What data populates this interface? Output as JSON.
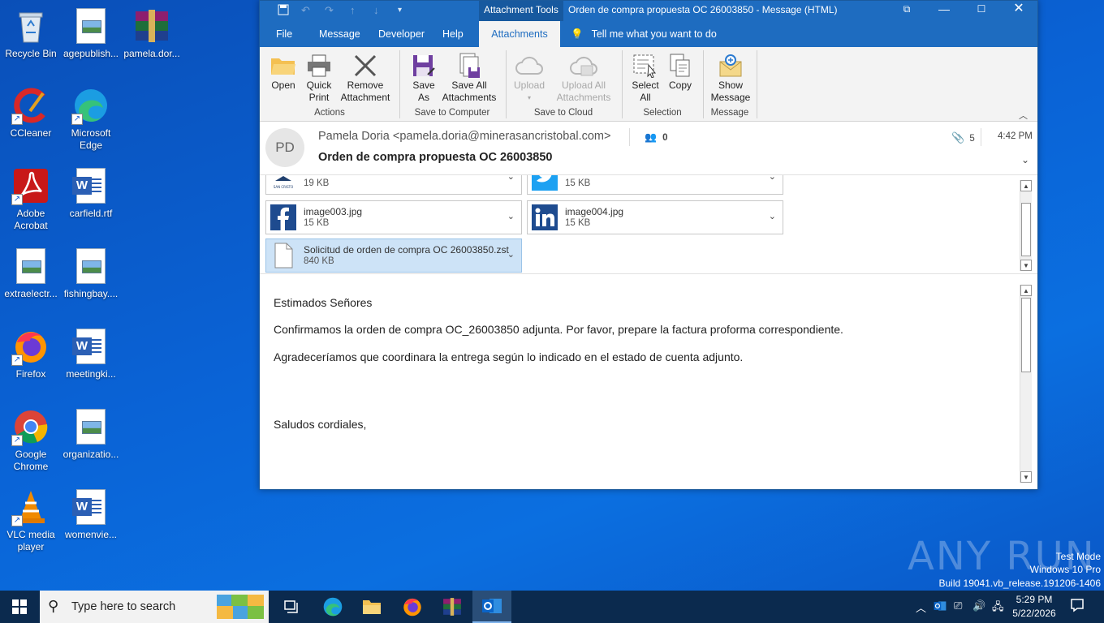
{
  "desktop": {
    "icons": [
      {
        "label": "Recycle Bin"
      },
      {
        "label": "agepublish..."
      },
      {
        "label": "pamela.dor..."
      },
      {
        "label": "CCleaner"
      },
      {
        "label": "Microsoft Edge"
      },
      {
        "label": "Adobe Acrobat"
      },
      {
        "label": "carfield.rtf"
      },
      {
        "label": "extraelectr..."
      },
      {
        "label": "fishingbay...."
      },
      {
        "label": "Firefox"
      },
      {
        "label": "meetingki..."
      },
      {
        "label": "Google Chrome"
      },
      {
        "label": "organizatio..."
      },
      {
        "label": "VLC media player"
      },
      {
        "label": "womenvie..."
      }
    ]
  },
  "window": {
    "context_tab": "Attachment Tools",
    "title": "Orden de compra propuesta OC 26003850  -  Message (HTML)",
    "tabs": [
      "File",
      "Message",
      "Developer",
      "Help",
      "Attachments"
    ],
    "active_tab": "Attachments",
    "tell_me": "Tell me what you want to do"
  },
  "ribbon": {
    "open": "Open",
    "quick_print_1": "Quick",
    "quick_print_2": "Print",
    "remove_1": "Remove",
    "remove_2": "Attachment",
    "group_actions": "Actions",
    "save_as_1": "Save",
    "save_as_2": "As",
    "save_all_1": "Save All",
    "save_all_2": "Attachments",
    "group_save_computer": "Save to Computer",
    "upload": "Upload",
    "upload_all_1": "Upload All",
    "upload_all_2": "Attachments",
    "group_save_cloud": "Save to Cloud",
    "select_all_1": "Select",
    "select_all_2": "All",
    "copy": "Copy",
    "group_selection": "Selection",
    "show_message_1": "Show",
    "show_message_2": "Message",
    "group_message": "Message"
  },
  "message": {
    "avatar_initials": "PD",
    "sender": "Pamela Doria <pamela.doria@minerasancristobal.com>",
    "subject": "Orden de compra propuesta OC 26003850",
    "people_count": "0",
    "attachment_count": "5",
    "time": "4:42 PM"
  },
  "attachments": [
    {
      "name": "",
      "size": "19 KB"
    },
    {
      "name": "",
      "size": "15 KB"
    },
    {
      "name": "image003.jpg",
      "size": "15 KB"
    },
    {
      "name": "image004.jpg",
      "size": "15 KB"
    },
    {
      "name": "Solicitud de orden de compra OC 26003850.zst",
      "size": "840 KB"
    }
  ],
  "body": {
    "line1": "Estimados Señores",
    "line2": "Confirmamos la orden de compra OC_26003850 adjunta. Por favor, prepare la factura proforma correspondiente.",
    "line3": "Agradeceríamos que coordinara la entrega según lo indicado en el estado de cuenta adjunto.",
    "line4": "Saludos cordiales,"
  },
  "watermark": {
    "brand": "ANY RUN",
    "test_mode": "Test Mode",
    "os": "Windows 10 Pro",
    "build": "Build 19041.vb_release.191206-1406"
  },
  "taskbar": {
    "search_placeholder": "Type here to search",
    "time": "5:29 PM",
    "date": "5/22/2026"
  }
}
